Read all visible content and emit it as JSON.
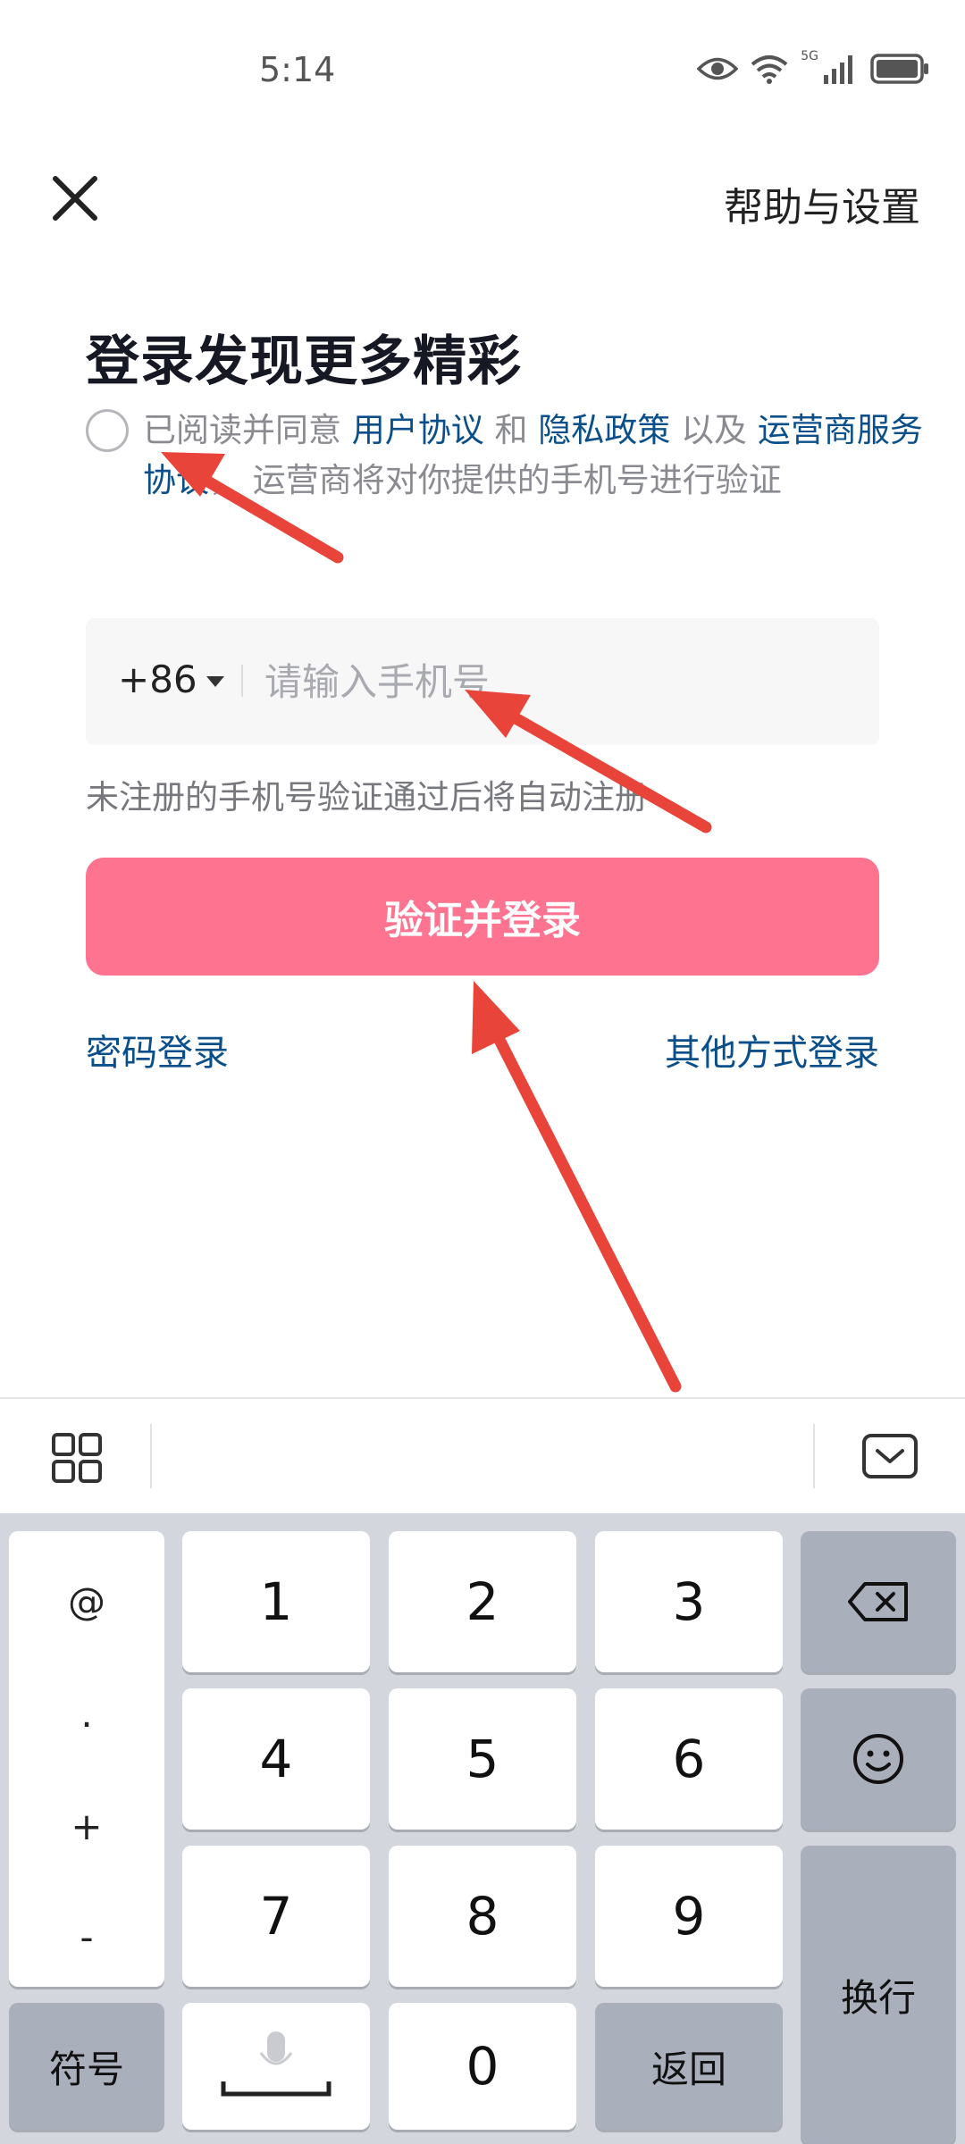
{
  "status_bar": {
    "time": "5:14",
    "network_label_top": "5G",
    "network_label_bottom": "1l",
    "icons": [
      "eye-icon",
      "wifi-icon",
      "cellular-signal-icon",
      "battery-icon"
    ]
  },
  "header": {
    "close_icon": "close-icon",
    "help_label": "帮助与设置"
  },
  "title": "登录发现更多精彩",
  "agreement": {
    "prefix": "已阅读并同意 ",
    "user_agreement": "用户协议",
    "and": " 和 ",
    "privacy_policy": "隐私政策",
    "and_also": " 以及 ",
    "carrier_agreement": "运营商服务协议",
    "suffix": "， 运营商将对你提供的手机号进行验证",
    "checked": false
  },
  "phone": {
    "country_code": "+86",
    "placeholder": "请输入手机号",
    "value": ""
  },
  "register_hint": "未注册的手机号验证通过后将自动注册",
  "login_button": "验证并登录",
  "password_login": "密码登录",
  "other_login": "其他方式登录",
  "keyboard": {
    "toolbar_icons": [
      "grid-icon",
      "keyboard-hide-icon"
    ],
    "symbols": [
      "@",
      ".",
      "+",
      "-"
    ],
    "digits": [
      "1",
      "2",
      "3",
      "4",
      "5",
      "6",
      "7",
      "8",
      "9",
      "0"
    ],
    "symbols_key": "符号",
    "return_key": "返回",
    "enter_key": "换行",
    "icons": [
      "backspace-icon",
      "emoji-icon",
      "microphone-icon"
    ]
  },
  "colors": {
    "accent_pink": "#fe7390",
    "link_blue": "#0b4f8a",
    "annotation_arrow": "#e8443a"
  }
}
